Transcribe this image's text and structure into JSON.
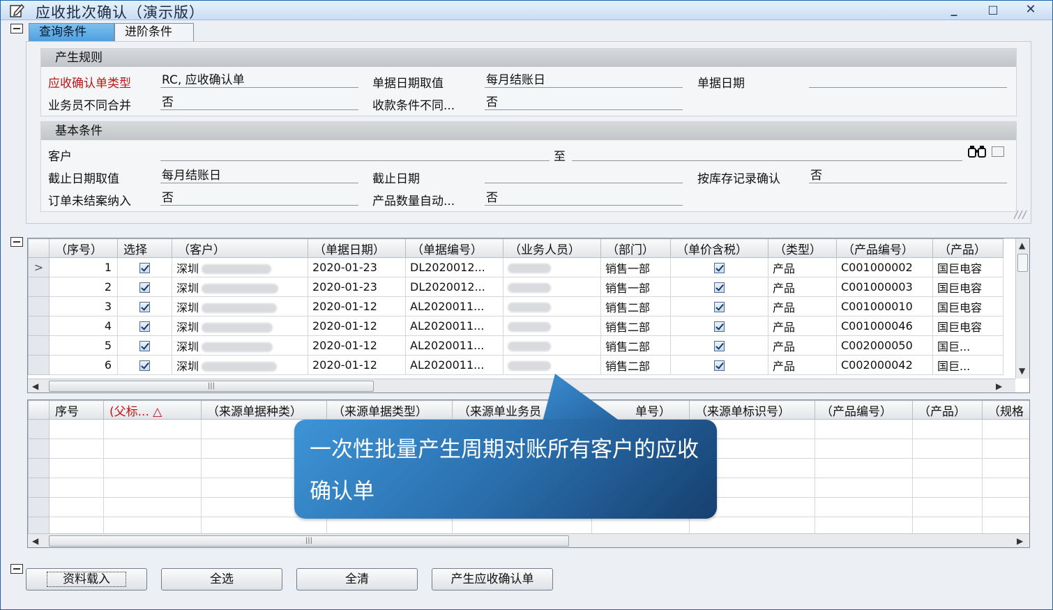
{
  "window": {
    "title": "应收批次确认（演示版）",
    "minimize": "_",
    "maximize": "□",
    "close": "✕"
  },
  "tabs": [
    {
      "label": "查询条件",
      "active": true
    },
    {
      "label": "进阶条件",
      "active": false
    }
  ],
  "rule_group": {
    "title": "产生规则",
    "fields": [
      {
        "label": "应收确认单类型",
        "value": "RC, 应收确认单"
      },
      {
        "label": "单据日期取值",
        "value": "每月结账日"
      },
      {
        "label": "单据日期",
        "value": ""
      },
      {
        "label": "业务员不同合并",
        "value": "否"
      },
      {
        "label": "收款条件不同...",
        "value": "否"
      }
    ]
  },
  "basic_group": {
    "title": "基本条件",
    "fields": [
      {
        "label": "客户",
        "value": ""
      },
      {
        "label": "至",
        "value": ""
      },
      {
        "label": "截止日期取值",
        "value": "每月结账日"
      },
      {
        "label": "截止日期",
        "value": ""
      },
      {
        "label": "按库存记录确认",
        "value": "否"
      },
      {
        "label": "订单未结案纳入",
        "value": "否"
      },
      {
        "label": "产品数量自动...",
        "value": "否"
      }
    ]
  },
  "upper_grid": {
    "columns": [
      "（序号）",
      "选择",
      "（客户）",
      "（单据日期）",
      "（单据编号）",
      "（业务人员）",
      "（部门）",
      "（单价含税）",
      "（类型）",
      "（产品编号）",
      "（产品）"
    ],
    "rows": [
      {
        "indicator": ">",
        "seq": "1",
        "selected": true,
        "customer": "深圳",
        "date": "2020-01-23",
        "no": "DL2020012...",
        "dept": "销售一部",
        "tax": true,
        "type": "产品",
        "pcode": "C001000002",
        "product": "国巨电容"
      },
      {
        "indicator": "",
        "seq": "2",
        "selected": true,
        "customer": "深圳",
        "date": "2020-01-23",
        "no": "DL2020012...",
        "dept": "销售一部",
        "tax": true,
        "type": "产品",
        "pcode": "C001000003",
        "product": "国巨电容"
      },
      {
        "indicator": "",
        "seq": "3",
        "selected": true,
        "customer": "深圳",
        "date": "2020-01-12",
        "no": "AL2020011...",
        "dept": "销售二部",
        "tax": true,
        "type": "产品",
        "pcode": "C001000010",
        "product": "国巨电容"
      },
      {
        "indicator": "",
        "seq": "4",
        "selected": true,
        "customer": "深圳",
        "date": "2020-01-12",
        "no": "AL2020011...",
        "dept": "销售二部",
        "tax": true,
        "type": "产品",
        "pcode": "C001000046",
        "product": "国巨电容"
      },
      {
        "indicator": "",
        "seq": "5",
        "selected": true,
        "customer": "深圳",
        "date": "2020-01-12",
        "no": "AL2020011...",
        "dept": "销售二部",
        "tax": true,
        "type": "产品",
        "pcode": "C002000050",
        "product": "国巨..."
      },
      {
        "indicator": "",
        "seq": "6",
        "selected": true,
        "customer": "深圳",
        "date": "2020-01-12",
        "no": "AL2020011...",
        "dept": "销售二部",
        "tax": true,
        "type": "产品",
        "pcode": "C002000042",
        "product": "国巨..."
      }
    ]
  },
  "lower_grid": {
    "columns": [
      "序号",
      "(父标... △",
      "（来源单据种类）",
      "（来源单据类型）",
      "（来源单业务员",
      "单号）",
      "（来源单标识号）",
      "（产品编号）",
      "（产品）",
      "（规格"
    ]
  },
  "callout": {
    "text": "一次性批量产生周期对账所有客户的应收确认单"
  },
  "buttons": [
    {
      "label": "资料载入"
    },
    {
      "label": "全选"
    },
    {
      "label": "全清"
    },
    {
      "label": "产生应收确认单"
    }
  ],
  "colors": {
    "accent": "#4d9ede",
    "required_label": "#c01515",
    "callout_dark": "#163f6e"
  }
}
